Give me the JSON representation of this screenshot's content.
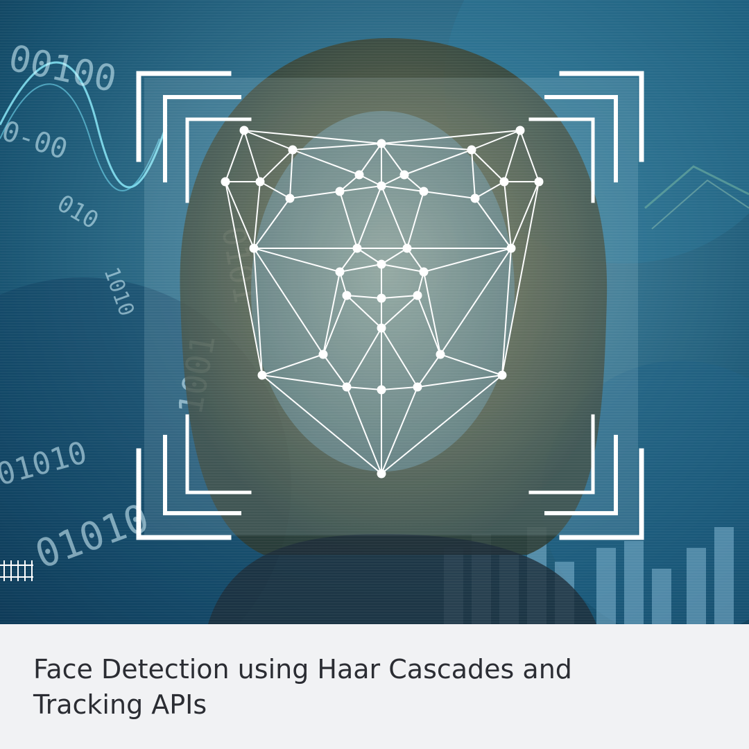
{
  "hero": {
    "alt": "Face detection illustration: a woman's face overlaid with a white facial-landmark mesh inside a square scanning frame on a blue binary-code background",
    "binary_strings": [
      "00100",
      "0-00",
      "010",
      "1010",
      "01010",
      "1001",
      "0101",
      "01010"
    ]
  },
  "caption": {
    "title": "Face Detection using Haar Cascades and Tracking APIs"
  },
  "colors": {
    "caption_bg": "#f1f2f4",
    "title_text": "#2b2d33",
    "mesh": "#ffffff",
    "frame": "#ffffff",
    "background_blue": "#2f6e8a"
  }
}
